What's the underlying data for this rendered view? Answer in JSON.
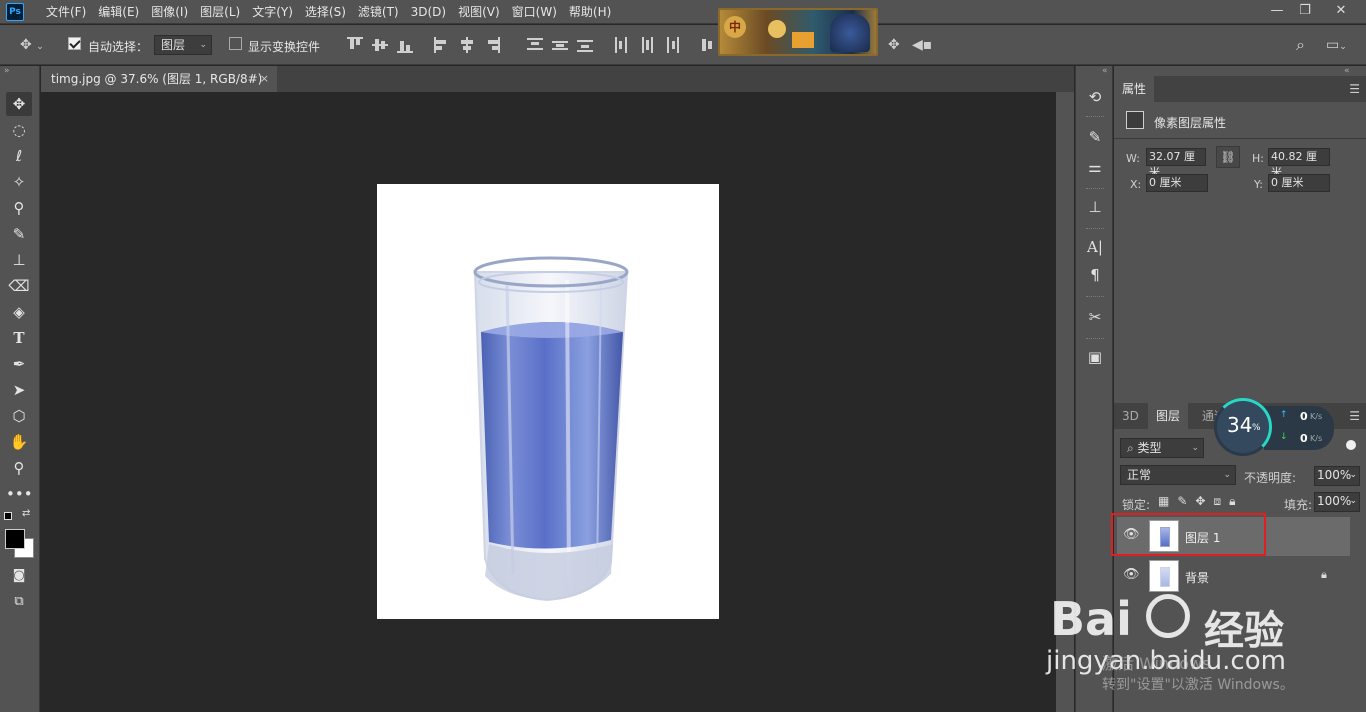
{
  "app": {
    "logo": "Ps"
  },
  "menu": [
    "文件(F)",
    "编辑(E)",
    "图像(I)",
    "图层(L)",
    "文字(Y)",
    "选择(S)",
    "滤镜(T)",
    "3D(D)",
    "视图(V)",
    "窗口(W)",
    "帮助(H)"
  ],
  "banner": {
    "char": "中"
  },
  "window_controls": {
    "minimize": "—",
    "restore": "❐",
    "close": "✕"
  },
  "options": {
    "auto_select_label": "自动选择：",
    "auto_select_checked": true,
    "auto_select_target": "图层",
    "show_transform_label": "显示变换控件",
    "show_transform_checked": false
  },
  "document": {
    "tab_title": "timg.jpg @ 37.6% (图层 1, RGB/8#) *",
    "close": "×"
  },
  "properties": {
    "tab": "属性",
    "section": "像素图层属性",
    "w_label": "W:",
    "w_value": "32.07 厘米",
    "h_label": "H:",
    "h_value": "40.82 厘米",
    "x_label": "X:",
    "x_value": "0 厘米",
    "y_label": "Y:",
    "y_value": "0 厘米"
  },
  "layers_panel": {
    "tabs": [
      "3D",
      "图层",
      "通道"
    ],
    "active_tab": "图层",
    "filter_label": "类型",
    "blend_mode": "正常",
    "opacity_label": "不透明度:",
    "opacity_value": "100%",
    "lock_label": "锁定:",
    "fill_label": "填充:",
    "fill_value": "100%",
    "layers": [
      {
        "name": "图层 1",
        "visible": true,
        "selected": true,
        "locked": false
      },
      {
        "name": "背景",
        "visible": true,
        "selected": false,
        "locked": true
      }
    ]
  },
  "speed_widget": {
    "percent": "34",
    "percent_unit": "%",
    "upload": "0",
    "download": "0",
    "unit": "K/s"
  },
  "watermark": {
    "logo_text": "Bai",
    "logo_text2": "经验",
    "url": "jingyan.baidu.com",
    "activate_line1": "激活 Windows",
    "activate_line2": "转到\"设置\"以激活 Windows。"
  }
}
